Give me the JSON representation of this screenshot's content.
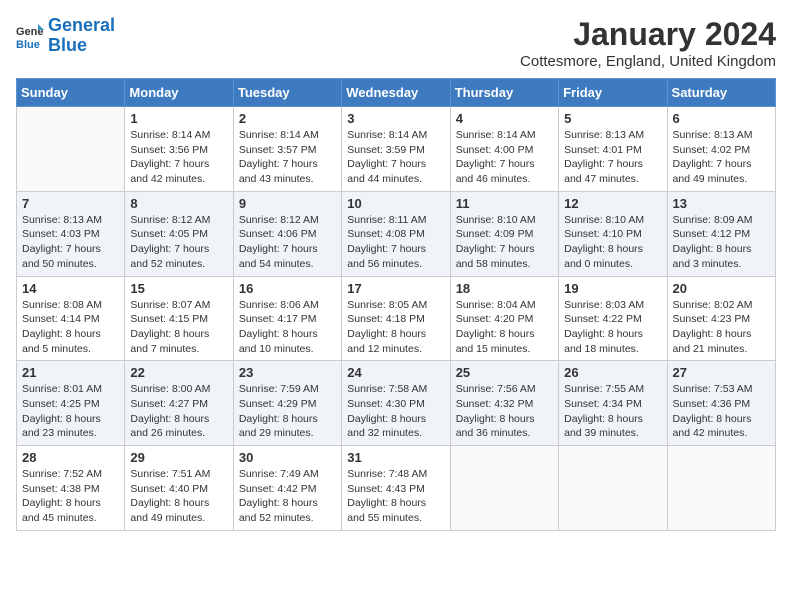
{
  "header": {
    "logo_line1": "General",
    "logo_line2": "Blue",
    "month": "January 2024",
    "location": "Cottesmore, England, United Kingdom"
  },
  "weekdays": [
    "Sunday",
    "Monday",
    "Tuesday",
    "Wednesday",
    "Thursday",
    "Friday",
    "Saturday"
  ],
  "weeks": [
    [
      {
        "num": "",
        "info": ""
      },
      {
        "num": "1",
        "info": "Sunrise: 8:14 AM\nSunset: 3:56 PM\nDaylight: 7 hours\nand 42 minutes."
      },
      {
        "num": "2",
        "info": "Sunrise: 8:14 AM\nSunset: 3:57 PM\nDaylight: 7 hours\nand 43 minutes."
      },
      {
        "num": "3",
        "info": "Sunrise: 8:14 AM\nSunset: 3:59 PM\nDaylight: 7 hours\nand 44 minutes."
      },
      {
        "num": "4",
        "info": "Sunrise: 8:14 AM\nSunset: 4:00 PM\nDaylight: 7 hours\nand 46 minutes."
      },
      {
        "num": "5",
        "info": "Sunrise: 8:13 AM\nSunset: 4:01 PM\nDaylight: 7 hours\nand 47 minutes."
      },
      {
        "num": "6",
        "info": "Sunrise: 8:13 AM\nSunset: 4:02 PM\nDaylight: 7 hours\nand 49 minutes."
      }
    ],
    [
      {
        "num": "7",
        "info": "Sunrise: 8:13 AM\nSunset: 4:03 PM\nDaylight: 7 hours\nand 50 minutes."
      },
      {
        "num": "8",
        "info": "Sunrise: 8:12 AM\nSunset: 4:05 PM\nDaylight: 7 hours\nand 52 minutes."
      },
      {
        "num": "9",
        "info": "Sunrise: 8:12 AM\nSunset: 4:06 PM\nDaylight: 7 hours\nand 54 minutes."
      },
      {
        "num": "10",
        "info": "Sunrise: 8:11 AM\nSunset: 4:08 PM\nDaylight: 7 hours\nand 56 minutes."
      },
      {
        "num": "11",
        "info": "Sunrise: 8:10 AM\nSunset: 4:09 PM\nDaylight: 7 hours\nand 58 minutes."
      },
      {
        "num": "12",
        "info": "Sunrise: 8:10 AM\nSunset: 4:10 PM\nDaylight: 8 hours\nand 0 minutes."
      },
      {
        "num": "13",
        "info": "Sunrise: 8:09 AM\nSunset: 4:12 PM\nDaylight: 8 hours\nand 3 minutes."
      }
    ],
    [
      {
        "num": "14",
        "info": "Sunrise: 8:08 AM\nSunset: 4:14 PM\nDaylight: 8 hours\nand 5 minutes."
      },
      {
        "num": "15",
        "info": "Sunrise: 8:07 AM\nSunset: 4:15 PM\nDaylight: 8 hours\nand 7 minutes."
      },
      {
        "num": "16",
        "info": "Sunrise: 8:06 AM\nSunset: 4:17 PM\nDaylight: 8 hours\nand 10 minutes."
      },
      {
        "num": "17",
        "info": "Sunrise: 8:05 AM\nSunset: 4:18 PM\nDaylight: 8 hours\nand 12 minutes."
      },
      {
        "num": "18",
        "info": "Sunrise: 8:04 AM\nSunset: 4:20 PM\nDaylight: 8 hours\nand 15 minutes."
      },
      {
        "num": "19",
        "info": "Sunrise: 8:03 AM\nSunset: 4:22 PM\nDaylight: 8 hours\nand 18 minutes."
      },
      {
        "num": "20",
        "info": "Sunrise: 8:02 AM\nSunset: 4:23 PM\nDaylight: 8 hours\nand 21 minutes."
      }
    ],
    [
      {
        "num": "21",
        "info": "Sunrise: 8:01 AM\nSunset: 4:25 PM\nDaylight: 8 hours\nand 23 minutes."
      },
      {
        "num": "22",
        "info": "Sunrise: 8:00 AM\nSunset: 4:27 PM\nDaylight: 8 hours\nand 26 minutes."
      },
      {
        "num": "23",
        "info": "Sunrise: 7:59 AM\nSunset: 4:29 PM\nDaylight: 8 hours\nand 29 minutes."
      },
      {
        "num": "24",
        "info": "Sunrise: 7:58 AM\nSunset: 4:30 PM\nDaylight: 8 hours\nand 32 minutes."
      },
      {
        "num": "25",
        "info": "Sunrise: 7:56 AM\nSunset: 4:32 PM\nDaylight: 8 hours\nand 36 minutes."
      },
      {
        "num": "26",
        "info": "Sunrise: 7:55 AM\nSunset: 4:34 PM\nDaylight: 8 hours\nand 39 minutes."
      },
      {
        "num": "27",
        "info": "Sunrise: 7:53 AM\nSunset: 4:36 PM\nDaylight: 8 hours\nand 42 minutes."
      }
    ],
    [
      {
        "num": "28",
        "info": "Sunrise: 7:52 AM\nSunset: 4:38 PM\nDaylight: 8 hours\nand 45 minutes."
      },
      {
        "num": "29",
        "info": "Sunrise: 7:51 AM\nSunset: 4:40 PM\nDaylight: 8 hours\nand 49 minutes."
      },
      {
        "num": "30",
        "info": "Sunrise: 7:49 AM\nSunset: 4:42 PM\nDaylight: 8 hours\nand 52 minutes."
      },
      {
        "num": "31",
        "info": "Sunrise: 7:48 AM\nSunset: 4:43 PM\nDaylight: 8 hours\nand 55 minutes."
      },
      {
        "num": "",
        "info": ""
      },
      {
        "num": "",
        "info": ""
      },
      {
        "num": "",
        "info": ""
      }
    ]
  ]
}
